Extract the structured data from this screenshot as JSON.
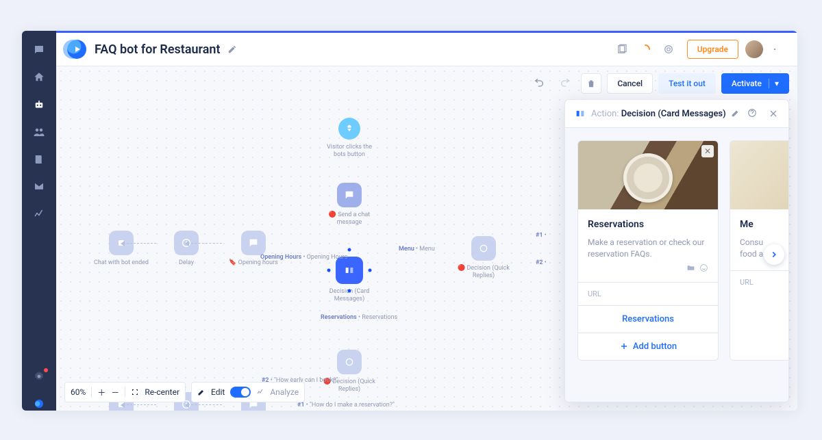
{
  "header": {
    "title": "FAQ bot for Restaurant",
    "upgrade": "Upgrade"
  },
  "actions": {
    "cancel": "Cancel",
    "test": "Test it out",
    "activate": "Activate"
  },
  "controls": {
    "zoom": "60%",
    "recenter": "Re-center",
    "edit": "Edit",
    "analyze": "Analyze"
  },
  "nodes": {
    "start": "Visitor clicks the bots button",
    "send_chat": "🔴 Send a chat message",
    "opening_hours_node": "🔖 Opening hours",
    "delay": "Delay",
    "chat_ended": "Chat with bot ended",
    "decision_card": "Decision (Card Messages)",
    "decision_quick1": "🔴 Decision (Quick Replies)",
    "decision_quick2": "🔴 Decision (Quick Replies)"
  },
  "edges": {
    "opening_hours": "Opening Hours",
    "opening_hours_sub": "Opening Hours",
    "menu": "Menu",
    "menu_sub": "Menu",
    "reservations": "Reservations",
    "reservations_sub": "Reservations",
    "branch1": "#1",
    "branch2": "#2",
    "q1": "\"How do I make a reservation?\"",
    "q2": "\"How early can I book?\""
  },
  "panel": {
    "prefix": "Action:",
    "title": "Decision (Card Messages)",
    "card1": {
      "title": "Reservations",
      "desc": "Make a reservation or check our reservation FAQs.",
      "url": "URL",
      "button": "Reservations",
      "add": "Add button"
    },
    "card2": {
      "title_partial": "Me",
      "desc_partial": "Consu\nfood a",
      "url": "URL"
    }
  }
}
